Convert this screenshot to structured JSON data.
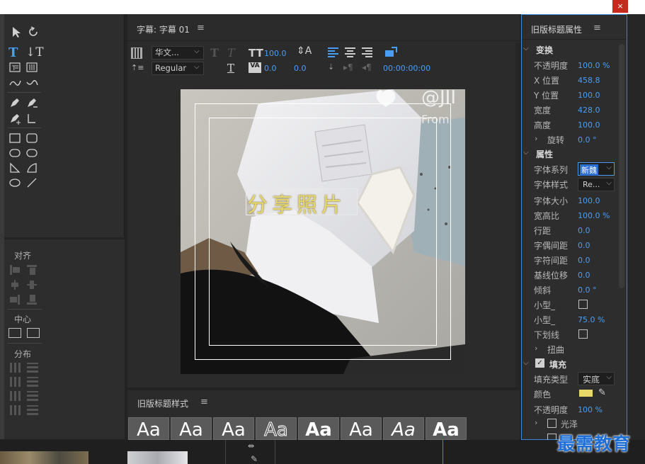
{
  "window": {
    "close_glyph": "×"
  },
  "title_panel": {
    "title": "字幕: 字幕 01",
    "font_family": "华文...",
    "font_style": "Regular",
    "font_size": "100.0",
    "kerning": "0.0",
    "leading": "0.0",
    "timecode": "00:00:00:00"
  },
  "canvas": {
    "caption_text": "分享照片",
    "photo_text_1": "@JII",
    "photo_text_2": "From"
  },
  "tools": {
    "align_label": "对齐",
    "center_label": "中心",
    "distribute_label": "分布"
  },
  "styles_panel": {
    "title": "旧版标题样式",
    "swatches": [
      "Aa",
      "Aa",
      "Aa",
      "Aa",
      "Aa",
      "Aa",
      "Aa",
      "Aa"
    ]
  },
  "properties": {
    "title": "旧版标题属性",
    "transform_header": "变换",
    "opacity_label": "不透明度",
    "opacity_value": "100.0 %",
    "xpos_label": "X 位置",
    "xpos_value": "458.8",
    "ypos_label": "Y 位置",
    "ypos_value": "100.0",
    "width_label": "宽度",
    "width_value": "428.0",
    "height_label": "高度",
    "height_value": "100.0",
    "rotation_label": "旋转",
    "rotation_value": "0.0 °",
    "attributes_header": "属性",
    "font_family_label": "字体系列",
    "font_family_value": "新魏",
    "font_style_label": "字体样式",
    "font_style_value": "Re...",
    "font_size_label": "字体大小",
    "font_size_value": "100.0",
    "aspect_label": "宽高比",
    "aspect_value": "100.0 %",
    "leading_label": "行距",
    "leading_value": "0.0",
    "kerning_label": "字偶间距",
    "kerning_value": "0.0",
    "tracking_label": "字符间距",
    "tracking_value": "0.0",
    "baseline_label": "基线位移",
    "baseline_value": "0.0",
    "slant_label": "倾斜",
    "slant_value": "0.0 °",
    "smallcaps_label": "小型_",
    "smallcaps_size_label": "小型_",
    "smallcaps_size_value": "75.0 %",
    "underline_label": "下划线",
    "distort_label": "扭曲",
    "fill_header": "填充",
    "fill_type_label": "填充类型",
    "fill_type_value": "实底",
    "color_label": "颜色",
    "fill_opacity_label": "不透明度",
    "fill_opacity_value": "100 %",
    "sheen_label": "光泽",
    "fill_color": "#e8d86a"
  },
  "watermark": {
    "text": "最需教育"
  }
}
